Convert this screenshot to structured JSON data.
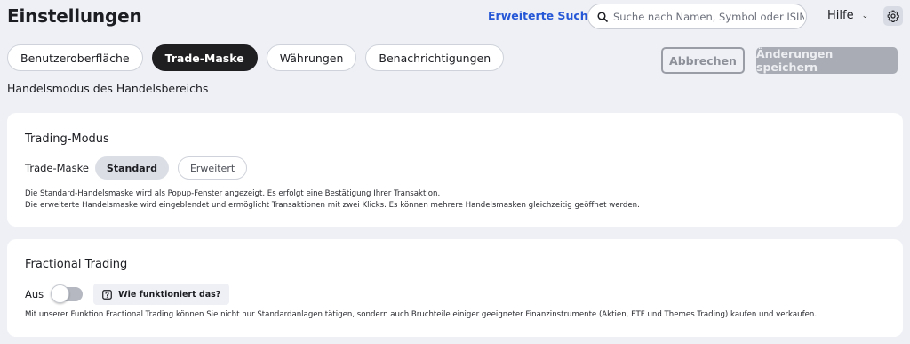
{
  "header": {
    "title": "Einstellungen",
    "advanced_search": "Erweiterte Suche",
    "search_placeholder": "Suche nach Namen, Symbol oder ISIN",
    "help": "Hilfe"
  },
  "tabs": [
    {
      "label": "Benutzeroberfläche",
      "active": false
    },
    {
      "label": "Trade-Maske",
      "active": true
    },
    {
      "label": "Währungen",
      "active": false
    },
    {
      "label": "Benachrichtigungen",
      "active": false
    }
  ],
  "actions": {
    "cancel": "Abbrechen",
    "save": "Änderungen speichern"
  },
  "section_subtitle": "Handelsmodus des Handelsbereichs",
  "trading_mode": {
    "title": "Trading-Modus",
    "label": "Trade-Maske",
    "options": [
      "Standard",
      "Erweitert"
    ],
    "selected": "Standard",
    "description_line1": "Die Standard-Handelsmaske wird als Popup-Fenster angezeigt. Es erfolgt eine Bestätigung Ihrer Transaktion.",
    "description_line2": "Die erweiterte Handelsmaske wird eingeblendet und ermöglicht Transaktionen mit zwei Klicks. Es können mehrere Handelsmasken gleichzeitig geöffnet werden."
  },
  "fractional": {
    "title": "Fractional Trading",
    "toggle_label": "Aus",
    "toggle_on": false,
    "how_label": "Wie funktioniert das?",
    "description": "Mit unserer Funktion Fractional Trading können Sie nicht nur Standardanlagen tätigen, sondern auch Bruchteile einiger geeigneter Finanzinstrumente (Aktien, ETF und Themes Trading) kaufen und verkaufen."
  },
  "colors": {
    "accent_link": "#2557d6",
    "active_tab": "#1f1f22",
    "background": "#eef0f5"
  },
  "icons": {
    "search": "search-icon",
    "help_chevron": "chevron-down-icon",
    "settings": "gear-icon",
    "how": "question-square-icon"
  }
}
